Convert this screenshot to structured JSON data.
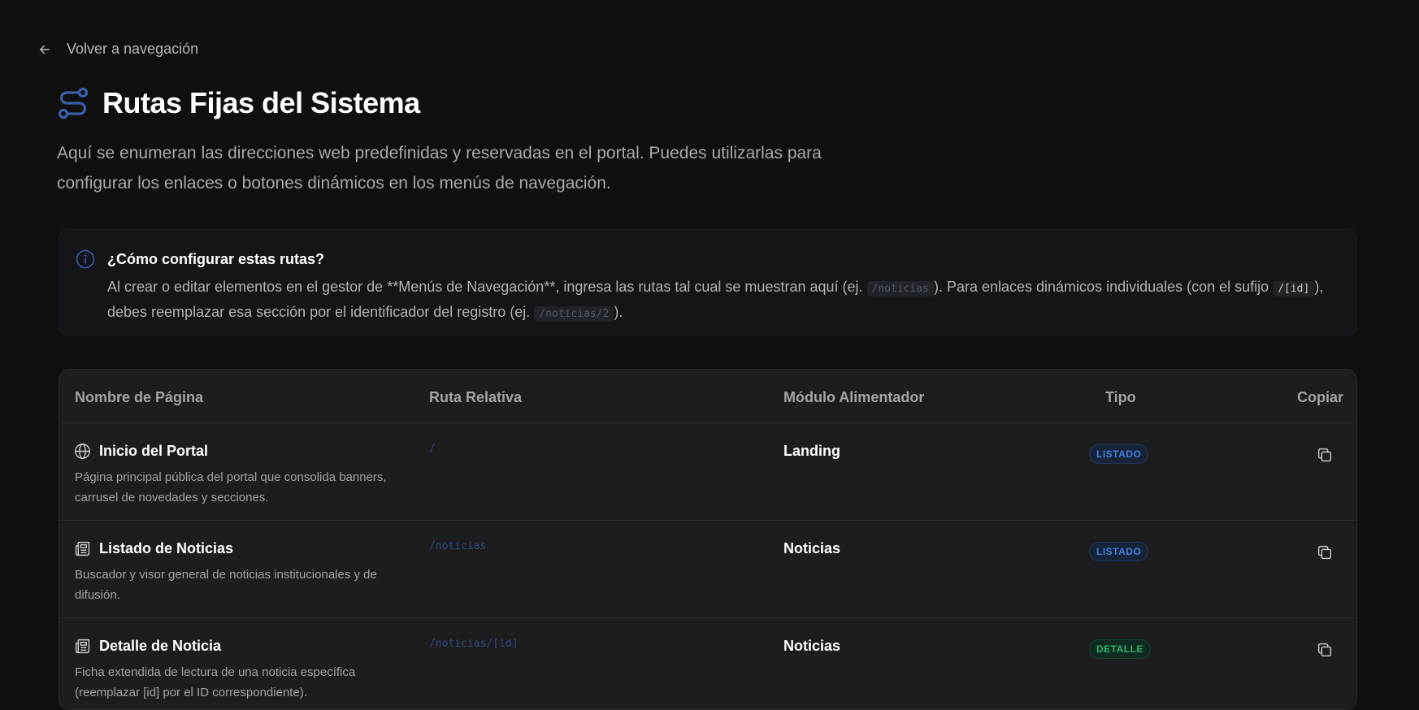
{
  "nav": {
    "back_label": "Volver a navegación"
  },
  "header": {
    "title": "Rutas Fijas del Sistema",
    "subtitle": "Aquí se enumeran las direcciones web predefinidas y reservadas en el portal. Puedes utilizarlas para configurar los enlaces o botones dinámicos en los menús de navegación.",
    "icon": "route-icon",
    "accent": "#3b5ea8"
  },
  "info": {
    "icon": "info-icon",
    "title": "¿Cómo configurar estas rutas?",
    "text_1": "Al crear o editar elementos en el gestor de **Menús de Navegación**, ingresa las rutas tal cual se muestran aquí (ej. ",
    "code_1": "/noticias",
    "text_2": "). Para enlaces dinámicos individuales (con el sufijo ",
    "code_2": "/[id]",
    "text_3": "), debes reemplazar esa sección por el identificador del registro (ej. ",
    "code_3": "/noticias/2",
    "text_4": ")."
  },
  "table": {
    "columns": {
      "name": "Nombre de Página",
      "route": "Ruta Relativa",
      "module": "Módulo Alimentador",
      "type": "Tipo",
      "copy": "Copiar"
    },
    "rows": [
      {
        "icon": "globe-icon",
        "name": "Inicio del Portal",
        "description": "Página principal pública del portal que consolida banners, carrusel de novedades y secciones.",
        "route": "/",
        "module": "Landing",
        "type": "LISTADO"
      },
      {
        "icon": "newspaper-icon",
        "name": "Listado de Noticias",
        "description": "Buscador y visor general de noticias institucionales y de difusión.",
        "route": "/noticias",
        "module": "Noticias",
        "type": "LISTADO"
      },
      {
        "icon": "newspaper-icon",
        "name": "Detalle de Noticia",
        "description": "Ficha extendida de lectura de una noticia específica (reemplazar [id] por el ID correspondiente).",
        "route": "/noticias/[id]",
        "module": "Noticias",
        "type": "DETALLE"
      }
    ]
  }
}
